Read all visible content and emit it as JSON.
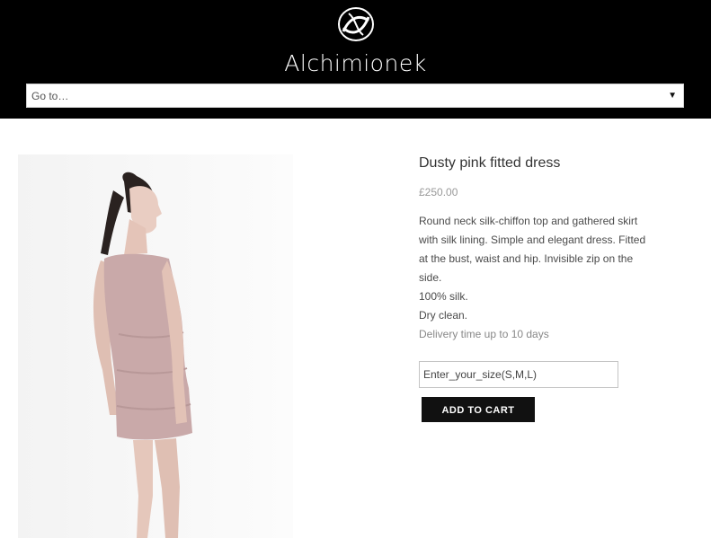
{
  "header": {
    "brand": "Alchimionek",
    "logo_icon": "interlaced-loops-logo-icon"
  },
  "nav": {
    "select_label": "Go to…",
    "arrow_icon": "triangle-down-icon",
    "arrow_glyph": "▼"
  },
  "product": {
    "image_description": "model-in-dusty-pink-dress-photo",
    "title": "Dusty pink fitted dress",
    "price": "£250.00",
    "description_lines": [
      "Round neck silk-chiffon top and gathered skirt with silk lining. Simple and elegant dress. Fitted at the bust, waist and hip. Invisible zip on the side.",
      "100% silk.",
      "Dry clean.",
      "Delivery time up to 10 days"
    ],
    "size_input_value": "Enter_your_size(S,M,L)",
    "add_to_cart_label": "ADD TO CART"
  },
  "colors": {
    "header_bg": "#000000",
    "button_bg": "#111111",
    "dress": "#c9a9a9"
  }
}
